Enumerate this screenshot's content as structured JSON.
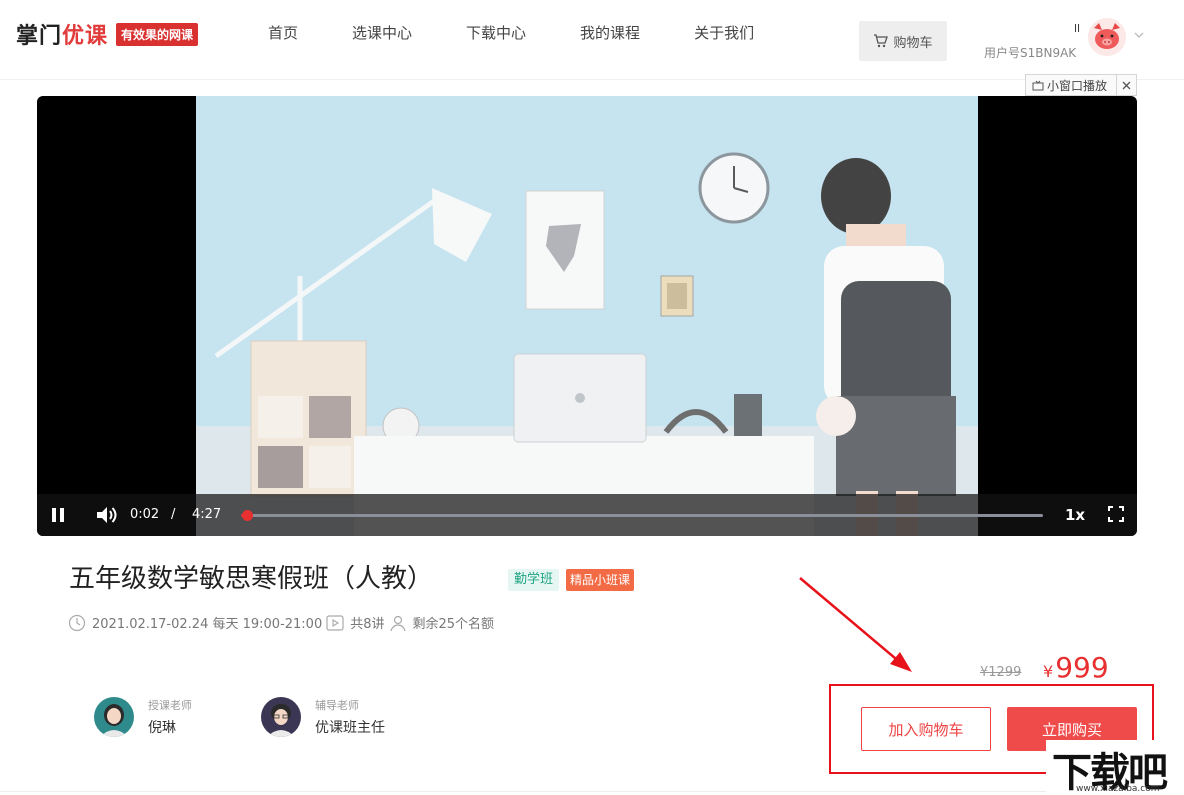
{
  "header": {
    "logo_main": "掌门",
    "logo_accent": "优课",
    "logo_badge": "有效果的网课",
    "nav": [
      "首页",
      "选课中心",
      "下载中心",
      "我的课程",
      "关于我们"
    ],
    "cart_label": "购物车",
    "user_short": "ll",
    "user_id": "用户号S1BN9AK",
    "mini_player_label": "小窗口播放"
  },
  "player": {
    "current_time": "0:02",
    "separator": "/",
    "duration": "4:27",
    "progress_fraction": 0.0075,
    "speed": "1x"
  },
  "course": {
    "title": "五年级数学敏思寒假班（人教）",
    "tags": [
      "勤学班",
      "精品小班课"
    ],
    "schedule": "2021.02.17-02.24 每天 19:00-21:00",
    "lessons": "共8讲",
    "seats": "剩余25个名额"
  },
  "teachers": [
    {
      "role": "授课老师",
      "name": "倪琳"
    },
    {
      "role": "辅导老师",
      "name": "优课班主任"
    }
  ],
  "pricing": {
    "old_price": "¥1299",
    "currency": "¥",
    "price": "999"
  },
  "actions": {
    "add_cart": "加入购物车",
    "buy_now": "立即购买"
  },
  "watermark": {
    "text": "下载吧",
    "url": "www.xiazaiba.com"
  },
  "colors": {
    "accent_red": "#ef4b4b",
    "tag_green": "#22a584",
    "tag_orange": "#f26b45",
    "annotation_red": "#e8121a"
  }
}
